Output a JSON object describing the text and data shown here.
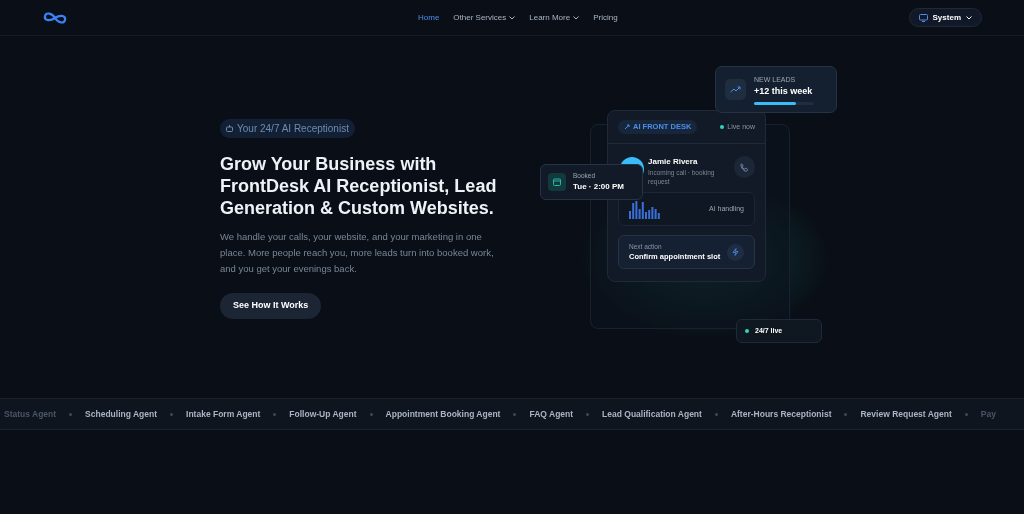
{
  "nav": {
    "links": [
      {
        "label": "Home",
        "selected": true,
        "dropdown": false
      },
      {
        "label": "Other Services",
        "selected": false,
        "dropdown": true
      },
      {
        "label": "Learn More",
        "selected": false,
        "dropdown": true
      },
      {
        "label": "Pricing",
        "selected": false,
        "dropdown": false
      }
    ],
    "theme_button": "System"
  },
  "hero": {
    "badge": "Your 24/7 AI Receptionist",
    "headline": "Grow Your Business with FrontDesk AI Receptionist, Lead Generation & Custom Websites.",
    "description": "We handle your calls, your website, and your marketing in one place. More people reach you, more leads turn into booked work, and you get your evenings back.",
    "cta": "See How It Works"
  },
  "dashboard": {
    "leads": {
      "label": "NEW LEADS",
      "value": "+12 this week",
      "level": 0.7
    },
    "tag": "AI FRONT DESK",
    "status": "Live now",
    "caller": {
      "name": "Jamie Rivera",
      "detail": "Incoming call · booking request"
    },
    "booked": {
      "label": "Booked",
      "value": "Tue · 2:00 PM"
    },
    "handling": "AI handling",
    "next": {
      "label": "Next action",
      "value": "Confirm appointment slot"
    },
    "live": "24/7 live"
  },
  "agents": [
    {
      "label": "Status Agent",
      "faded": true
    },
    {
      "label": "Scheduling Agent",
      "faded": false
    },
    {
      "label": "Intake Form Agent",
      "faded": false
    },
    {
      "label": "Follow-Up Agent",
      "faded": false
    },
    {
      "label": "Appointment Booking Agent",
      "faded": false
    },
    {
      "label": "FAQ Agent",
      "faded": false
    },
    {
      "label": "Lead Qualification Agent",
      "faded": false
    },
    {
      "label": "After-Hours Receptionist",
      "faded": false
    },
    {
      "label": "Review Request Agent",
      "faded": false
    },
    {
      "label": "Pay",
      "faded": true
    }
  ]
}
